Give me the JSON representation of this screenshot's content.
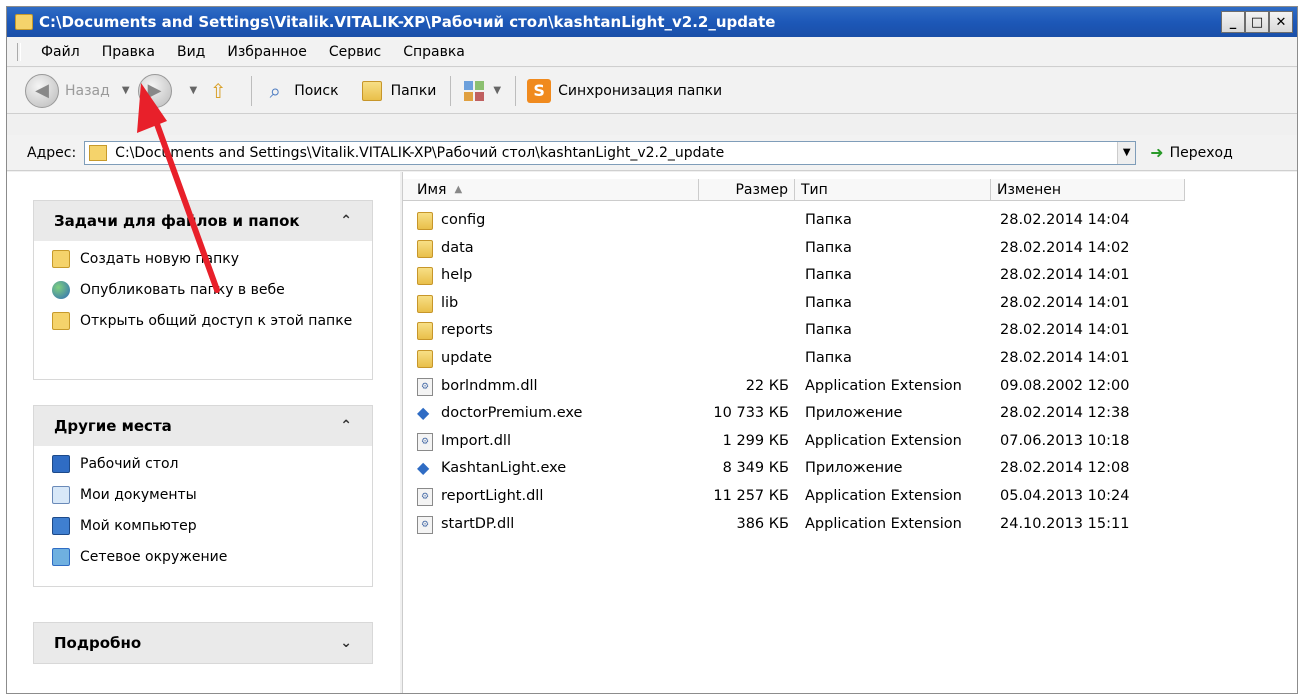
{
  "window": {
    "title": "C:\\Documents and Settings\\Vitalik.VITALIK-XP\\Рабочий стол\\kashtanLight_v2.2_update"
  },
  "menu": [
    "Файл",
    "Правка",
    "Вид",
    "Избранное",
    "Сервис",
    "Справка"
  ],
  "toolbar": {
    "back": "Назад",
    "search": "Поиск",
    "folders": "Папки",
    "sync": "Синхронизация папки"
  },
  "address": {
    "label": "Адрес:",
    "path": "C:\\Documents and Settings\\Vitalik.VITALIK-XP\\Рабочий стол\\kashtanLight_v2.2_update",
    "go": "Переход"
  },
  "tasks": {
    "title": "Задачи для файлов и папок",
    "items": [
      "Создать новую папку",
      "Опубликовать папку в вебе",
      "Открыть общий доступ к этой папке"
    ]
  },
  "places": {
    "title": "Другие места",
    "items": [
      "Рабочий стол",
      "Мои документы",
      "Мой компьютер",
      "Сетевое окружение"
    ]
  },
  "details": {
    "title": "Подробно"
  },
  "columns": {
    "name": "Имя",
    "size": "Размер",
    "type": "Тип",
    "modified": "Изменен"
  },
  "files": [
    {
      "name": "config",
      "size": "",
      "type": "Папка",
      "modified": "28.02.2014 14:04",
      "kind": "folder"
    },
    {
      "name": "data",
      "size": "",
      "type": "Папка",
      "modified": "28.02.2014 14:02",
      "kind": "folder"
    },
    {
      "name": "help",
      "size": "",
      "type": "Папка",
      "modified": "28.02.2014 14:01",
      "kind": "folder"
    },
    {
      "name": "lib",
      "size": "",
      "type": "Папка",
      "modified": "28.02.2014 14:01",
      "kind": "folder"
    },
    {
      "name": "reports",
      "size": "",
      "type": "Папка",
      "modified": "28.02.2014 14:01",
      "kind": "folder"
    },
    {
      "name": "update",
      "size": "",
      "type": "Папка",
      "modified": "28.02.2014 14:01",
      "kind": "folder"
    },
    {
      "name": "borlndmm.dll",
      "size": "22 КБ",
      "type": "Application Extension",
      "modified": "09.08.2002 12:00",
      "kind": "dll"
    },
    {
      "name": "doctorPremium.exe",
      "size": "10 733 КБ",
      "type": "Приложение",
      "modified": "28.02.2014 12:38",
      "kind": "exe"
    },
    {
      "name": "Import.dll",
      "size": "1 299 КБ",
      "type": "Application Extension",
      "modified": "07.06.2013 10:18",
      "kind": "dll"
    },
    {
      "name": "KashtanLight.exe",
      "size": "8 349 КБ",
      "type": "Приложение",
      "modified": "28.02.2014 12:08",
      "kind": "exe"
    },
    {
      "name": "reportLight.dll",
      "size": "11 257 КБ",
      "type": "Application Extension",
      "modified": "05.04.2013 10:24",
      "kind": "dll"
    },
    {
      "name": "startDP.dll",
      "size": "386 КБ",
      "type": "Application Extension",
      "modified": "24.10.2013 15:11",
      "kind": "dll"
    }
  ],
  "annotation": {
    "color": "#e8202a"
  }
}
